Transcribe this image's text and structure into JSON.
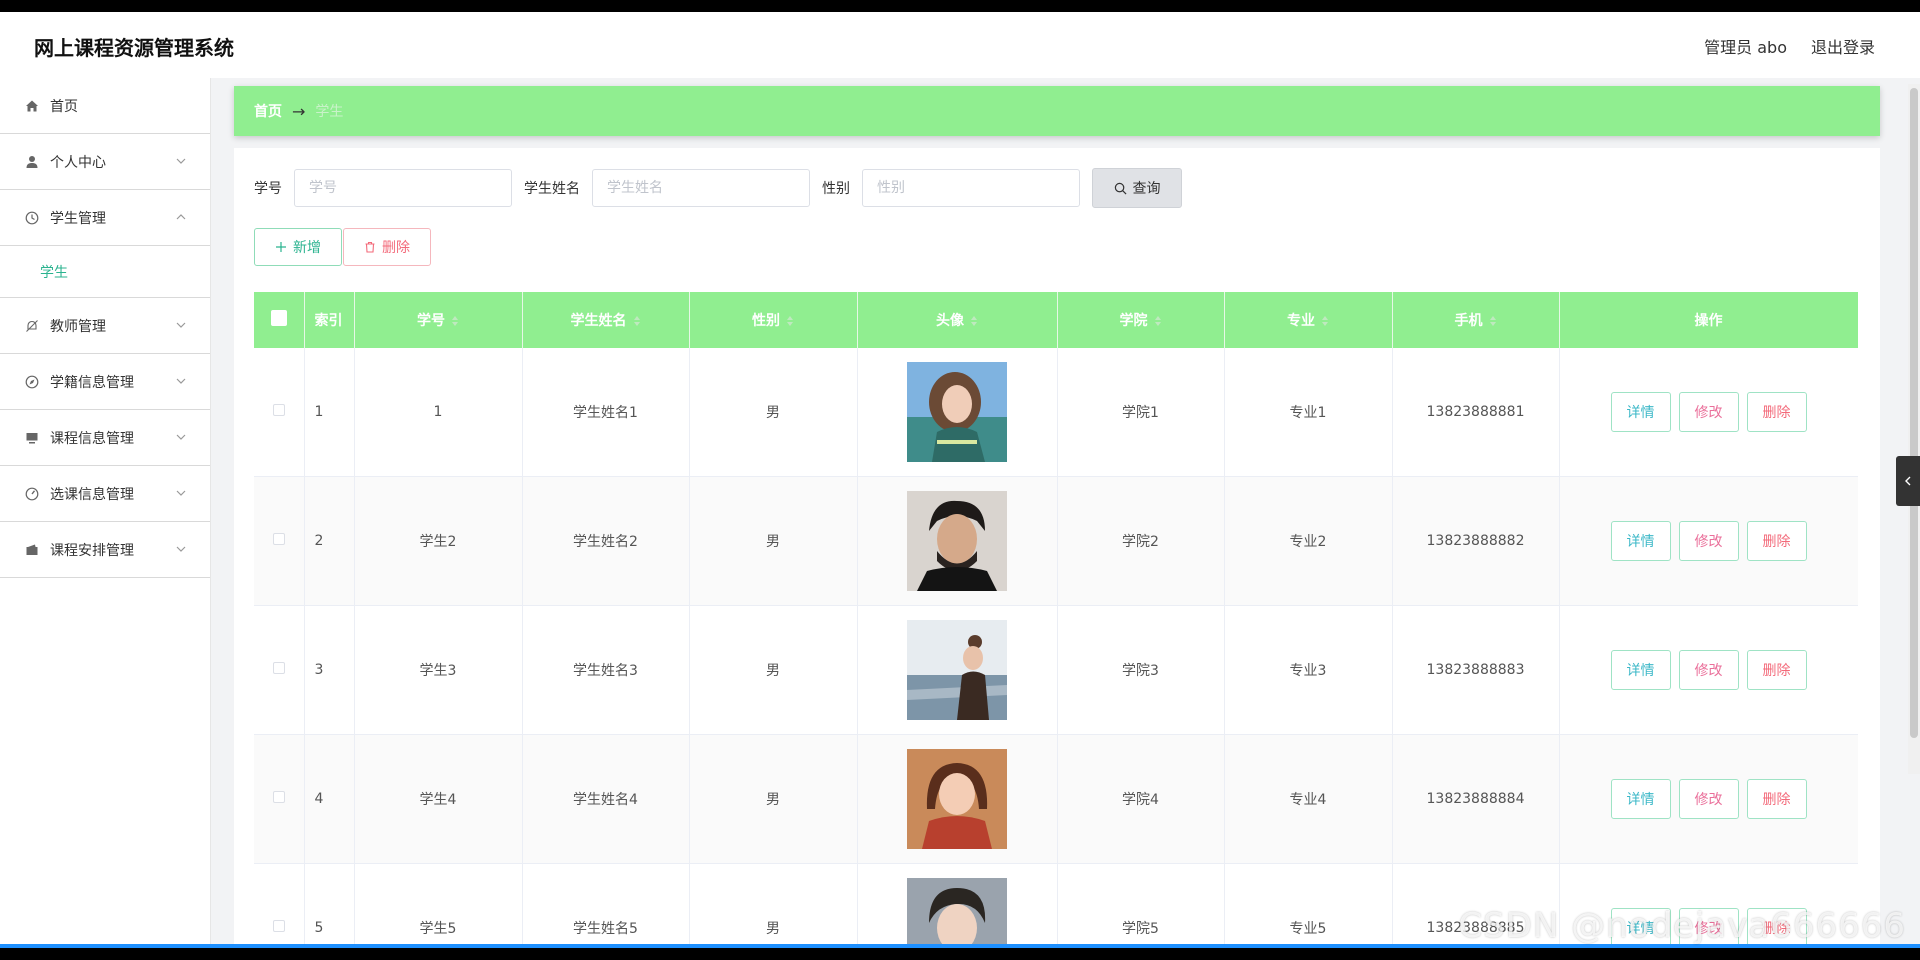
{
  "app": {
    "title": "网上课程资源管理系统",
    "admin_label": "管理员 abo",
    "logout_label": "退出登录"
  },
  "sidebar": {
    "items": [
      {
        "label": "首页",
        "icon": "home-icon"
      },
      {
        "label": "个人中心",
        "icon": "user-icon"
      },
      {
        "label": "学生管理",
        "icon": "clock-icon",
        "expanded": true
      },
      {
        "label": "教师管理",
        "icon": "bell-off-icon"
      },
      {
        "label": "学籍信息管理",
        "icon": "compass-icon"
      },
      {
        "label": "课程信息管理",
        "icon": "monitor-icon"
      },
      {
        "label": "选课信息管理",
        "icon": "gauge-icon"
      },
      {
        "label": "课程安排管理",
        "icon": "wallet-icon"
      }
    ],
    "sub_items": [
      {
        "label": "学生"
      }
    ],
    "active_color": "#2bb38f"
  },
  "breadcrumb": {
    "home": "首页",
    "arrow": "→",
    "current": "学生"
  },
  "search": {
    "student_no_label": "学号",
    "student_no_placeholder": "学号",
    "student_name_label": "学生姓名",
    "student_name_placeholder": "学生姓名",
    "gender_label": "性别",
    "gender_placeholder": "性别",
    "query_label": "查询"
  },
  "actions": {
    "add_label": "新增",
    "delete_label": "删除"
  },
  "table": {
    "columns": [
      "索引",
      "学号",
      "学生姓名",
      "性别",
      "头像",
      "学院",
      "专业",
      "手机",
      "操作"
    ],
    "rows": [
      {
        "index": "1",
        "student_no": "1",
        "name": "学生姓名1",
        "gender": "男",
        "college": "学院1",
        "major": "专业1",
        "phone": "13823888881"
      },
      {
        "index": "2",
        "student_no": "学生2",
        "name": "学生姓名2",
        "gender": "男",
        "college": "学院2",
        "major": "专业2",
        "phone": "13823888882"
      },
      {
        "index": "3",
        "student_no": "学生3",
        "name": "学生姓名3",
        "gender": "男",
        "college": "学院3",
        "major": "专业3",
        "phone": "13823888883"
      },
      {
        "index": "4",
        "student_no": "学生4",
        "name": "学生姓名4",
        "gender": "男",
        "college": "学院4",
        "major": "专业4",
        "phone": "13823888884"
      },
      {
        "index": "5",
        "student_no": "学生5",
        "name": "学生姓名5",
        "gender": "男",
        "college": "学院5",
        "major": "专业5",
        "phone": "13823888885"
      }
    ],
    "op_detail": "详情",
    "op_edit": "修改",
    "op_delete": "删除",
    "header_color": "#90ee90"
  },
  "watermark": "CSDN @nodejava666666"
}
